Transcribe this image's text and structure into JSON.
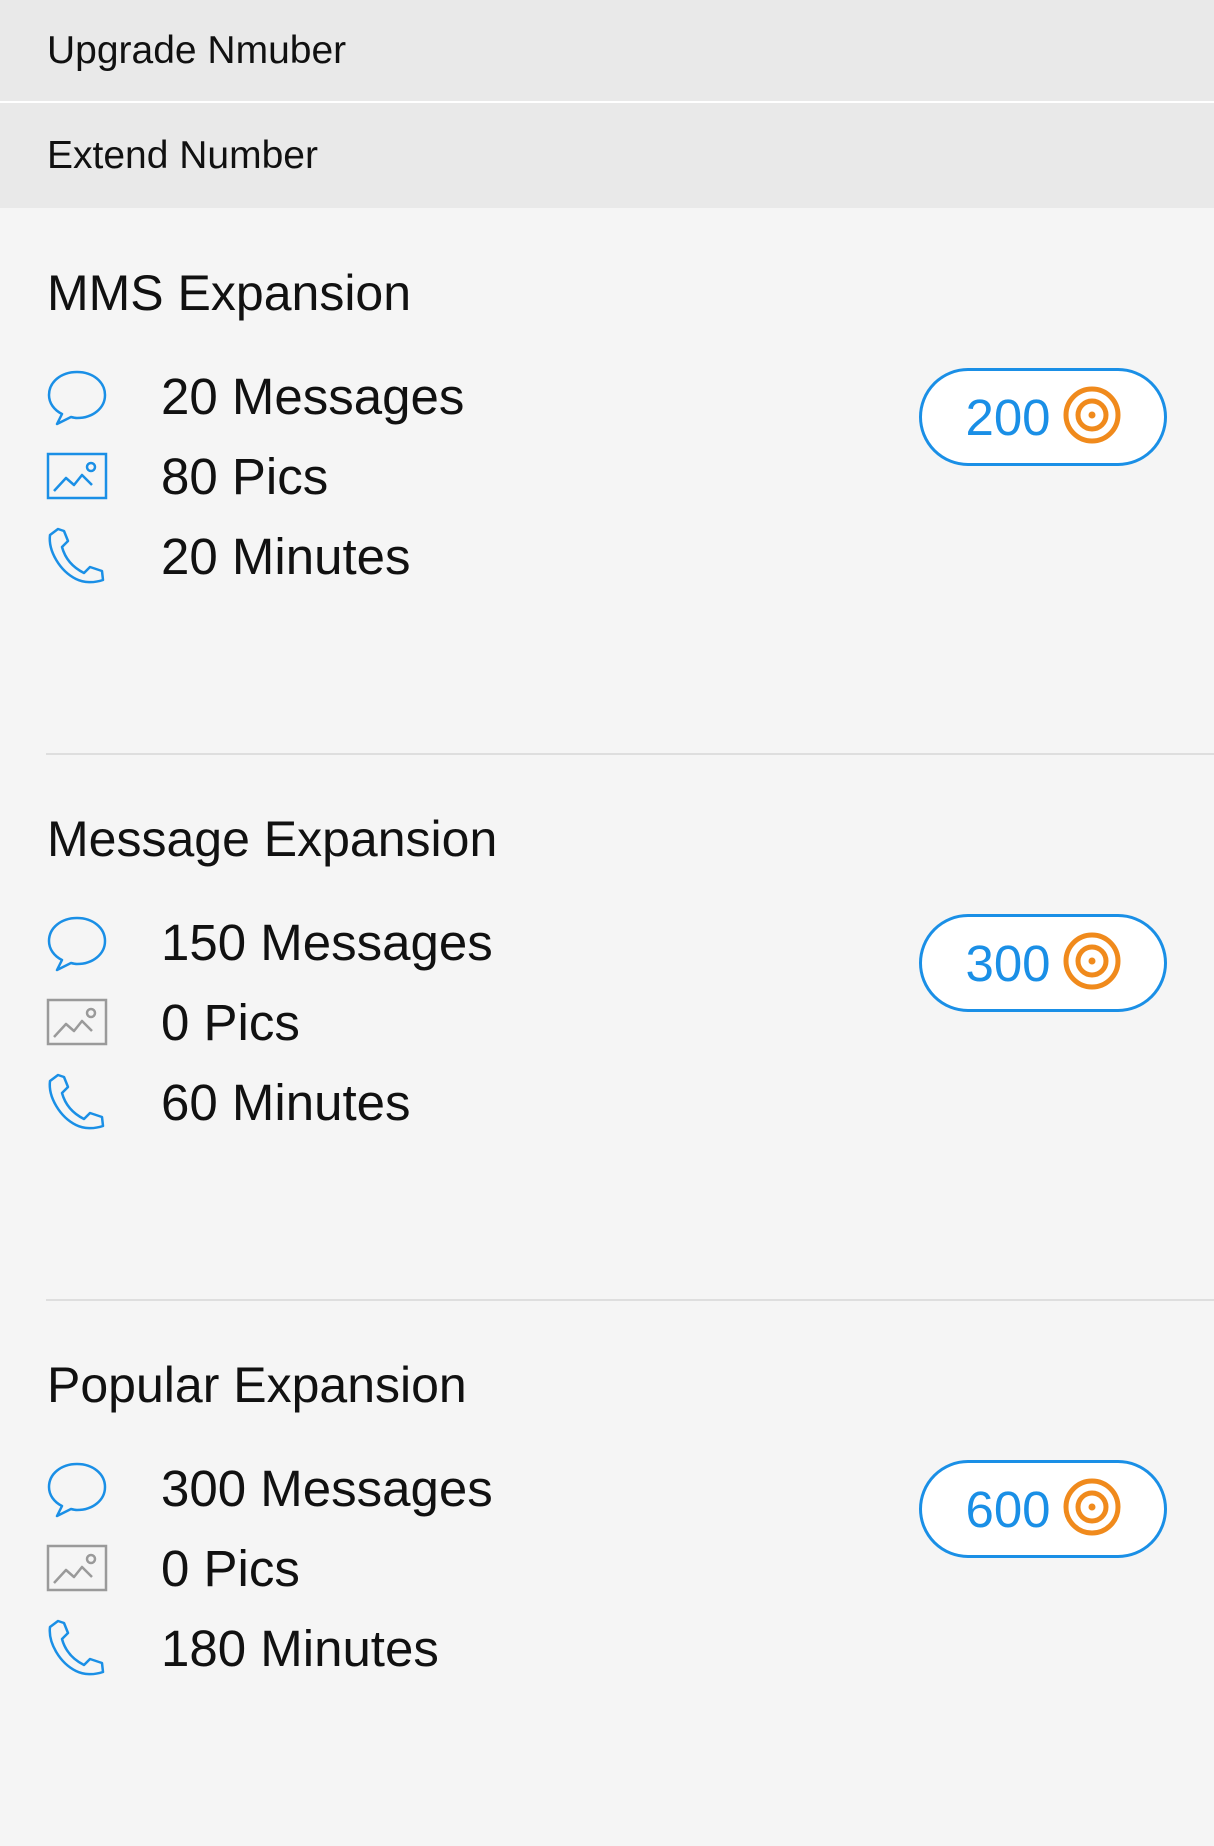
{
  "menu": {
    "upgrade_label": "Upgrade Nmuber",
    "extend_label": "Extend Number"
  },
  "colors": {
    "accent": "#1a8fe6",
    "coin": "#f08a1c",
    "disabled_icon": "#9a9a9a",
    "background": "#f5f5f5",
    "menu_background": "#e9e9e9"
  },
  "plans": [
    {
      "title": "MMS Expansion",
      "messages": "20 Messages",
      "pics": "80 Pics",
      "pics_icon_active": true,
      "minutes": "20 Minutes",
      "price": "200",
      "price_icon": "coin-icon"
    },
    {
      "title": "Message Expansion",
      "messages": "150 Messages",
      "pics": "0 Pics",
      "pics_icon_active": false,
      "minutes": "60 Minutes",
      "price": "300",
      "price_icon": "coin-icon"
    },
    {
      "title": "Popular Expansion",
      "messages": "300 Messages",
      "pics": "0 Pics",
      "pics_icon_active": false,
      "minutes": "180 Minutes",
      "price": "600",
      "price_icon": "coin-icon"
    }
  ]
}
